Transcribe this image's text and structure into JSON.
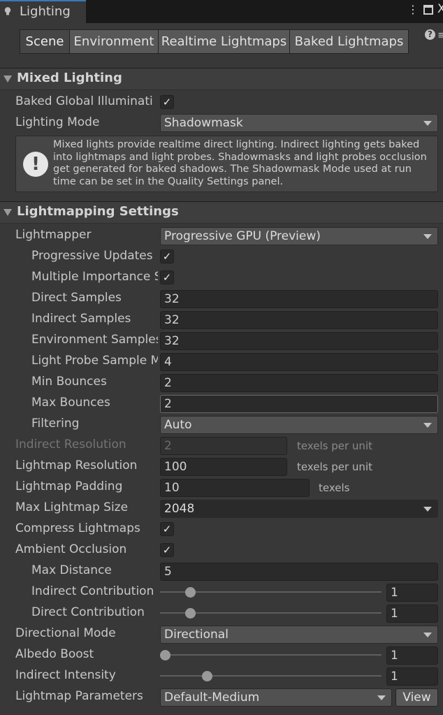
{
  "window": {
    "title": "Lighting",
    "icon": "lightbulb-icon",
    "menu_icon": "kebab-menu-icon",
    "maximize_icon": "maximize-icon",
    "close_glyph": "X"
  },
  "toolbar": {
    "tabs": [
      "Scene",
      "Environment",
      "Realtime Lightmaps",
      "Baked Lightmaps"
    ],
    "active_tab": "Scene",
    "help_glyph": "?",
    "overflow_glyph": "≡"
  },
  "mixed_lighting": {
    "header": "Mixed Lighting",
    "baked_gi": {
      "label": "Baked Global Illuminati",
      "checked": "✓"
    },
    "lighting_mode": {
      "label": "Lighting Mode",
      "value": "Shadowmask"
    },
    "info": {
      "glyph": "!",
      "text": "Mixed lights provide realtime direct lighting. Indirect lighting gets baked into lightmaps and light probes. Shadowmasks and light probes occlusion get generated for baked shadows. The Shadowmask Mode used at run time can be set in the Quality Settings panel."
    }
  },
  "lightmapping": {
    "header": "Lightmapping Settings",
    "lightmapper": {
      "label": "Lightmapper",
      "value": "Progressive GPU (Preview)"
    },
    "progressive_updates": {
      "label": "Progressive Updates",
      "checked": "✓"
    },
    "multiple_importance": {
      "label": "Multiple Importance S",
      "checked": "✓"
    },
    "direct_samples": {
      "label": "Direct Samples",
      "value": "32"
    },
    "indirect_samples": {
      "label": "Indirect Samples",
      "value": "32"
    },
    "environment_samples": {
      "label": "Environment Samples",
      "value": "32"
    },
    "light_probe_sample": {
      "label": "Light Probe Sample M",
      "value": "4"
    },
    "min_bounces": {
      "label": "Min Bounces",
      "value": "2"
    },
    "max_bounces": {
      "label": "Max Bounces",
      "value": "2"
    },
    "filtering": {
      "label": "Filtering",
      "value": "Auto"
    },
    "indirect_resolution": {
      "label": "Indirect Resolution",
      "value": "2",
      "unit": "texels per unit"
    },
    "lightmap_resolution": {
      "label": "Lightmap Resolution",
      "value": "100",
      "unit": "texels per unit"
    },
    "lightmap_padding": {
      "label": "Lightmap Padding",
      "value": "10",
      "unit": "texels"
    },
    "max_lightmap_size": {
      "label": "Max Lightmap Size",
      "value": "2048"
    },
    "compress_lightmaps": {
      "label": "Compress Lightmaps",
      "checked": "✓"
    },
    "ambient_occlusion": {
      "label": "Ambient Occlusion",
      "checked": "✓"
    },
    "max_distance": {
      "label": "Max Distance",
      "value": "5"
    },
    "indirect_contribution": {
      "label": "Indirect Contribution",
      "value": "1",
      "slider_fraction": 0.12
    },
    "direct_contribution": {
      "label": "Direct Contribution",
      "value": "1",
      "slider_fraction": 0.12
    },
    "directional_mode": {
      "label": "Directional Mode",
      "value": "Directional"
    },
    "albedo_boost": {
      "label": "Albedo Boost",
      "value": "1",
      "slider_fraction": 0.0
    },
    "indirect_intensity": {
      "label": "Indirect Intensity",
      "value": "1",
      "slider_fraction": 0.2
    },
    "lightmap_parameters": {
      "label": "Lightmap Parameters",
      "value": "Default-Medium",
      "view_label": "View"
    }
  }
}
